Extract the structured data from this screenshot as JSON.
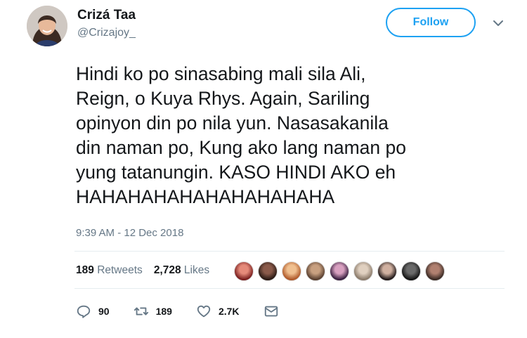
{
  "user": {
    "name": "Crizá Taa",
    "handle": "@Crizajoy_"
  },
  "follow_label": "Follow",
  "tweet": {
    "lines": [
      "Hindi ko po sinasabing mali sila Ali,",
      "Reign, o Kuya Rhys. Again, Sariling",
      "opinyon din po nila yun. Nasasakanila",
      "din naman po, Kung ako lang naman po",
      "yung tatanungin. KASO HINDI AKO eh",
      "HAHAHAHAHAHAHAHAHAHA"
    ],
    "timestamp": "9:39 AM - 12 Dec 2018"
  },
  "stats": {
    "retweets_count": "189",
    "retweets_label": "Retweets",
    "likes_count": "2,728",
    "likes_label": "Likes"
  },
  "actions": {
    "replies": "90",
    "retweets": "189",
    "likes": "2.7K"
  },
  "colors": {
    "accent": "#1da1f2",
    "text": "#14171a",
    "muted": "#657786"
  }
}
